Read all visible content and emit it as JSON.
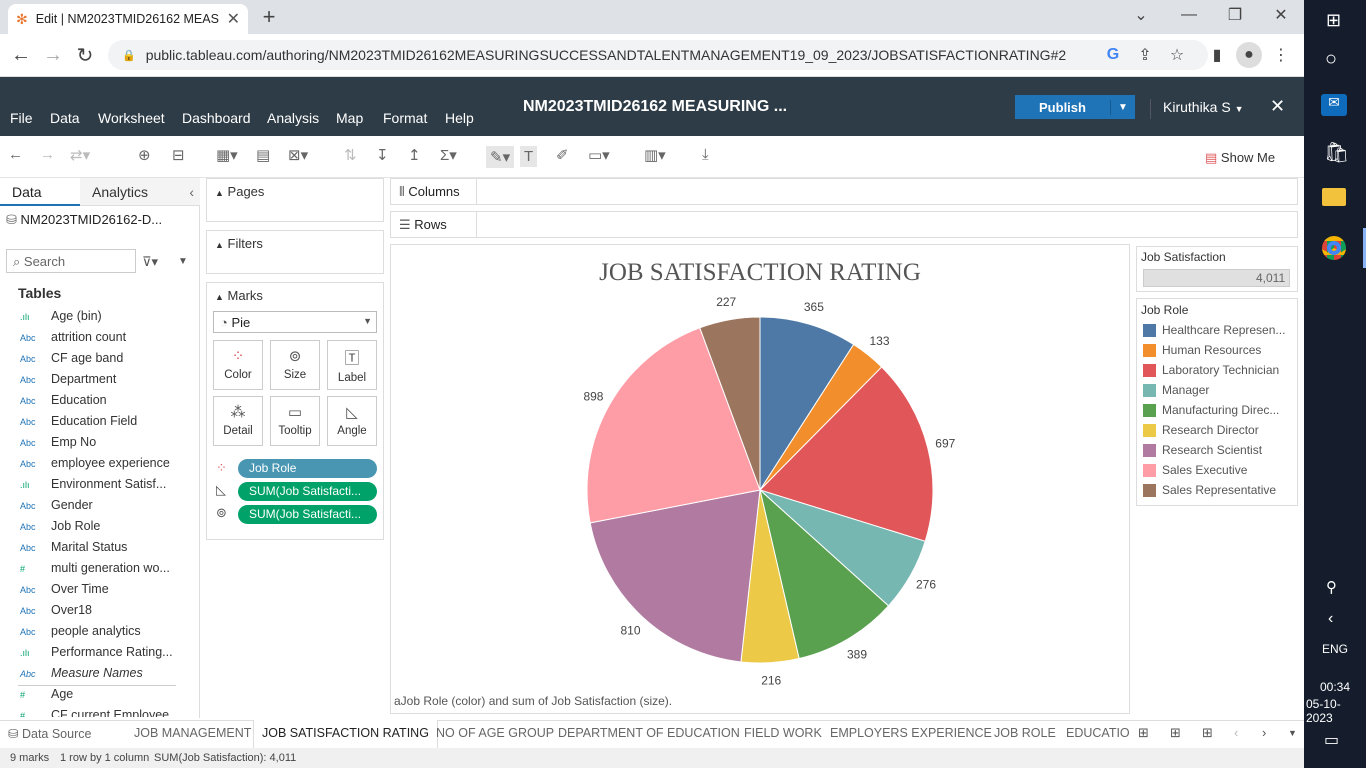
{
  "browser": {
    "tab_title": "Edit | NM2023TMID26162 MEAS",
    "url": "public.tableau.com/authoring/NM2023TMID26162MEASURINGSUCCESSANDTALENTMANAGEMENT19_09_2023/JOBSATISFACTIONRATING#2"
  },
  "menu": {
    "items": [
      "File",
      "Data",
      "Worksheet",
      "Dashboard",
      "Analysis",
      "Map",
      "Format",
      "Help"
    ],
    "workbook_title": "NM2023TMID26162 MEASURING ...",
    "publish_label": "Publish",
    "user": "Kiruthika S"
  },
  "toolbar": {
    "show_me": "Show Me"
  },
  "data_pane": {
    "tab_data": "Data",
    "tab_analytics": "Analytics",
    "datasource": "NM2023TMID26162-D...",
    "search_placeholder": "Search",
    "tables_label": "Tables",
    "fields": [
      {
        "type": ".ılı",
        "name": "Age (bin)"
      },
      {
        "type": "Abc",
        "name": "attrition count"
      },
      {
        "type": "Abc",
        "name": "CF age band"
      },
      {
        "type": "Abc",
        "name": "Department"
      },
      {
        "type": "Abc",
        "name": "Education"
      },
      {
        "type": "Abc",
        "name": "Education Field"
      },
      {
        "type": "Abc",
        "name": "Emp No"
      },
      {
        "type": "Abc",
        "name": "employee experience"
      },
      {
        "type": ".ılı",
        "name": "Environment Satisf..."
      },
      {
        "type": "Abc",
        "name": "Gender"
      },
      {
        "type": "Abc",
        "name": "Job Role"
      },
      {
        "type": "Abc",
        "name": "Marital Status"
      },
      {
        "type": "#",
        "name": "multi generation wo..."
      },
      {
        "type": "Abc",
        "name": "Over Time"
      },
      {
        "type": "Abc",
        "name": "Over18"
      },
      {
        "type": "Abc",
        "name": "people analytics"
      },
      {
        "type": ".ılı",
        "name": "Performance Rating..."
      },
      {
        "type": "Abc",
        "name": "Measure Names"
      },
      {
        "type": "#",
        "name": "Age"
      },
      {
        "type": "#",
        "name": "CF current Employee"
      }
    ]
  },
  "shelves": {
    "pages": "Pages",
    "filters": "Filters",
    "marks": "Marks",
    "mark_type": "Pie",
    "mark_buttons": [
      "Color",
      "Size",
      "Label",
      "Detail",
      "Tooltip",
      "Angle"
    ],
    "pills": [
      "Job Role",
      "SUM(Job Satisfacti...",
      "SUM(Job Satisfacti..."
    ],
    "columns": "Columns",
    "rows": "Rows"
  },
  "size_legend": {
    "title": "Job Satisfaction",
    "value": "4,011"
  },
  "color_legend": {
    "title": "Job Role"
  },
  "caption": "aJob Role (color) and sum of Job Satisfaction (size).",
  "chart_data": {
    "type": "pie",
    "title": "JOB SATISFACTION RATING",
    "categories": [
      "Healthcare Represen...",
      "Human Resources",
      "Laboratory Technician",
      "Manager",
      "Manufacturing Direc...",
      "Research Director",
      "Research Scientist",
      "Sales Executive",
      "Sales Representative"
    ],
    "values": [
      365,
      133,
      697,
      276,
      389,
      216,
      810,
      898,
      227
    ],
    "colors": [
      "#4e79a7",
      "#f28e2b",
      "#e15759",
      "#76b7b2",
      "#59a14f",
      "#edc948",
      "#b07aa1",
      "#ff9da7",
      "#9c755f"
    ],
    "legend": "right"
  },
  "sheet_tabs": [
    "Data Source",
    "JOB MANAGEMENT",
    "JOB SATISFACTION RATING",
    "NO OF AGE GROUP",
    "DEPARTMENT OF EDUCATION",
    "FIELD WORK",
    "EMPLOYERS EXPERIENCE",
    "JOB ROLE",
    "EDUCATIO"
  ],
  "status": {
    "marks": "9 marks",
    "dims": "1 row by 1 column",
    "sum": "SUM(Job Satisfaction): 4,011"
  },
  "taskbar": {
    "lang": "ENG",
    "time": "00:34",
    "date": "05-10-2023"
  }
}
